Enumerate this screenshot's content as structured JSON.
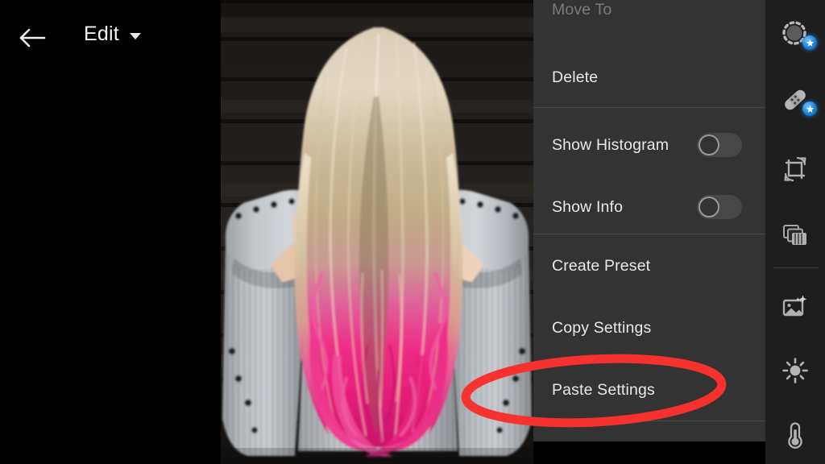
{
  "app": {
    "background_color": "#000000",
    "accent_color": "#2f80d8",
    "annotation_color": "#f5322e",
    "menu_bg": "#333333",
    "sidebar_bg": "#1e1e1e"
  },
  "header": {
    "back_icon": "back-arrow-icon",
    "title": "Edit",
    "caret_icon": "chevron-down-icon"
  },
  "photo": {
    "alt": "Woman photographed from behind with hands in her long blonde hair dip-dyed bright pink, wearing a grey ribbed knit sweater, dark wood siding background"
  },
  "menu": {
    "items": [
      {
        "label": "Move To",
        "name": "menu-item-move-to",
        "type": "action",
        "state": "dimmed"
      },
      {
        "label": "Delete",
        "name": "menu-item-delete",
        "type": "action",
        "state": "normal"
      },
      {
        "label": "Show Histogram",
        "name": "menu-item-show-histogram",
        "type": "toggle",
        "state": "normal",
        "value": "off"
      },
      {
        "label": "Show Info",
        "name": "menu-item-show-info",
        "type": "toggle",
        "state": "normal",
        "value": "off"
      },
      {
        "label": "Create Preset",
        "name": "menu-item-create-preset",
        "type": "action",
        "state": "normal"
      },
      {
        "label": "Copy Settings",
        "name": "menu-item-copy-settings",
        "type": "action",
        "state": "normal"
      },
      {
        "label": "Paste Settings",
        "name": "menu-item-paste-settings",
        "type": "action",
        "state": "highlighted"
      }
    ]
  },
  "annotation": {
    "shape": "ellipse",
    "color": "#f5322e",
    "targets": "Paste Settings"
  },
  "sidebar": {
    "items": [
      {
        "name": "sidebar-item-select-subject",
        "icon": "dashed-circle-select-icon",
        "badge": "ai-star-badge"
      },
      {
        "name": "sidebar-item-healing",
        "icon": "healing-bandage-icon",
        "badge": "ai-star-badge"
      },
      {
        "name": "sidebar-item-crop",
        "icon": "crop-rotate-icon",
        "badge": ""
      },
      {
        "name": "sidebar-item-versions",
        "icon": "layers-stack-icon",
        "badge": ""
      },
      {
        "name": "sidebar-item-presets",
        "icon": "image-sparkle-icon",
        "badge": ""
      },
      {
        "name": "sidebar-item-light",
        "icon": "sun-brightness-icon",
        "badge": ""
      },
      {
        "name": "sidebar-item-color",
        "icon": "thermometer-icon",
        "badge": ""
      }
    ]
  }
}
